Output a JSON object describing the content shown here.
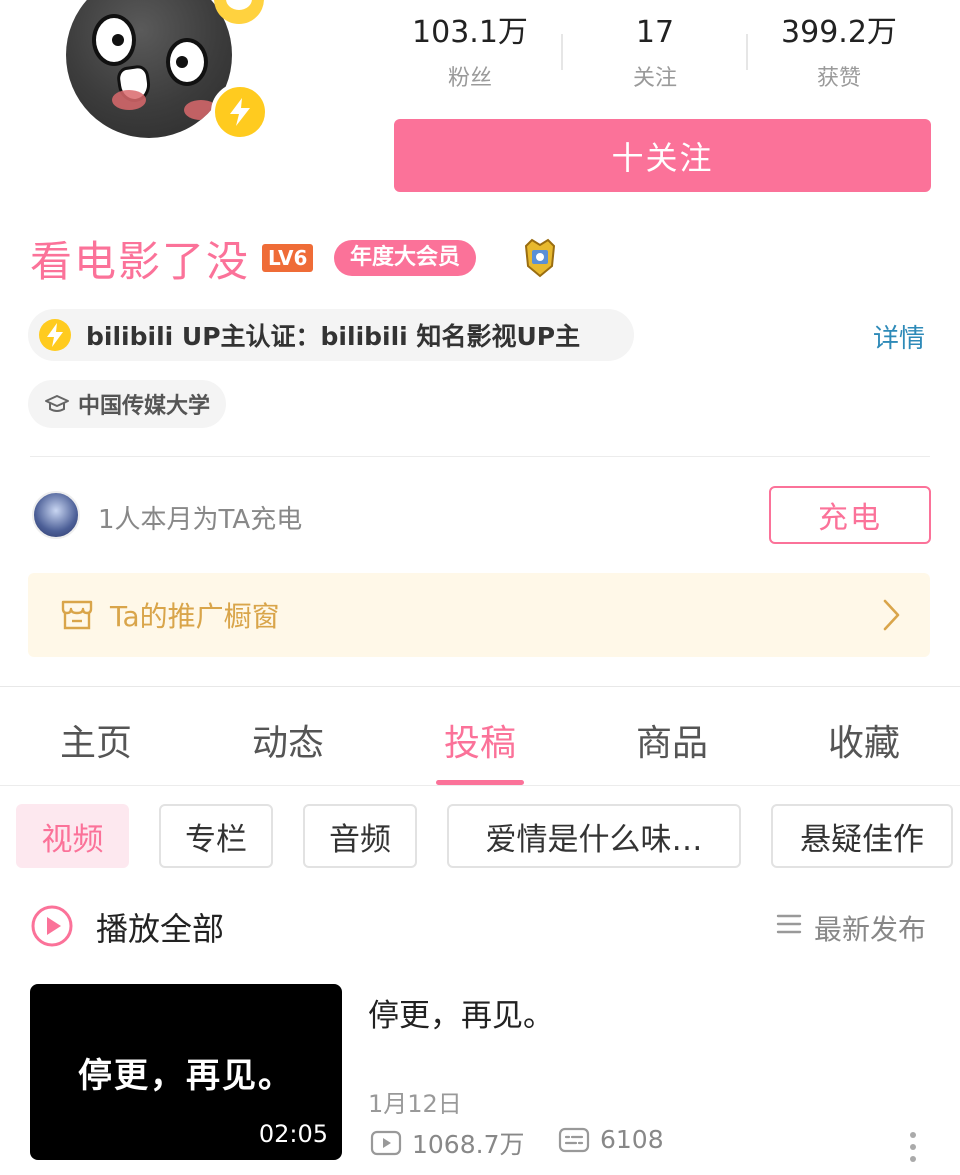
{
  "profile": {
    "name": "看电影了没",
    "level_badge": "LV6",
    "vip_badge": "年度大会员",
    "stats": [
      {
        "value": "103.1万",
        "label": "粉丝"
      },
      {
        "value": "17",
        "label": "关注"
      },
      {
        "value": "399.2万",
        "label": "获赞"
      }
    ],
    "follow_label": "十关注",
    "certification": "bilibili UP主认证：bilibili 知名影视UP主",
    "detail_link": "详情",
    "school": "中国传媒大学"
  },
  "charge": {
    "text": "1人本月为TA充电",
    "button_label": "充电"
  },
  "showcase": {
    "label": "Ta的推广橱窗"
  },
  "tabs": [
    {
      "label": "主页",
      "active": false
    },
    {
      "label": "动态",
      "active": false
    },
    {
      "label": "投稿",
      "active": true
    },
    {
      "label": "商品",
      "active": false
    },
    {
      "label": "收藏",
      "active": false
    }
  ],
  "filters": [
    {
      "label": "视频",
      "active": true
    },
    {
      "label": "专栏",
      "active": false
    },
    {
      "label": "音频",
      "active": false
    },
    {
      "label": "爱情是什么味…",
      "active": false
    },
    {
      "label": "悬疑佳作",
      "active": false
    }
  ],
  "list_header": {
    "play_all": "播放全部",
    "sort": "最新发布"
  },
  "video": {
    "thumbnail_text": "停更，再见。",
    "duration": "02:05",
    "title": "停更，再见。",
    "date": "1月12日",
    "views": "1068.7万",
    "danmaku": "6108"
  },
  "colors": {
    "accent": "#fb7299",
    "link": "#2e8ab8",
    "showcase_bg": "#fff8e8",
    "showcase_text": "#d9a54a"
  }
}
